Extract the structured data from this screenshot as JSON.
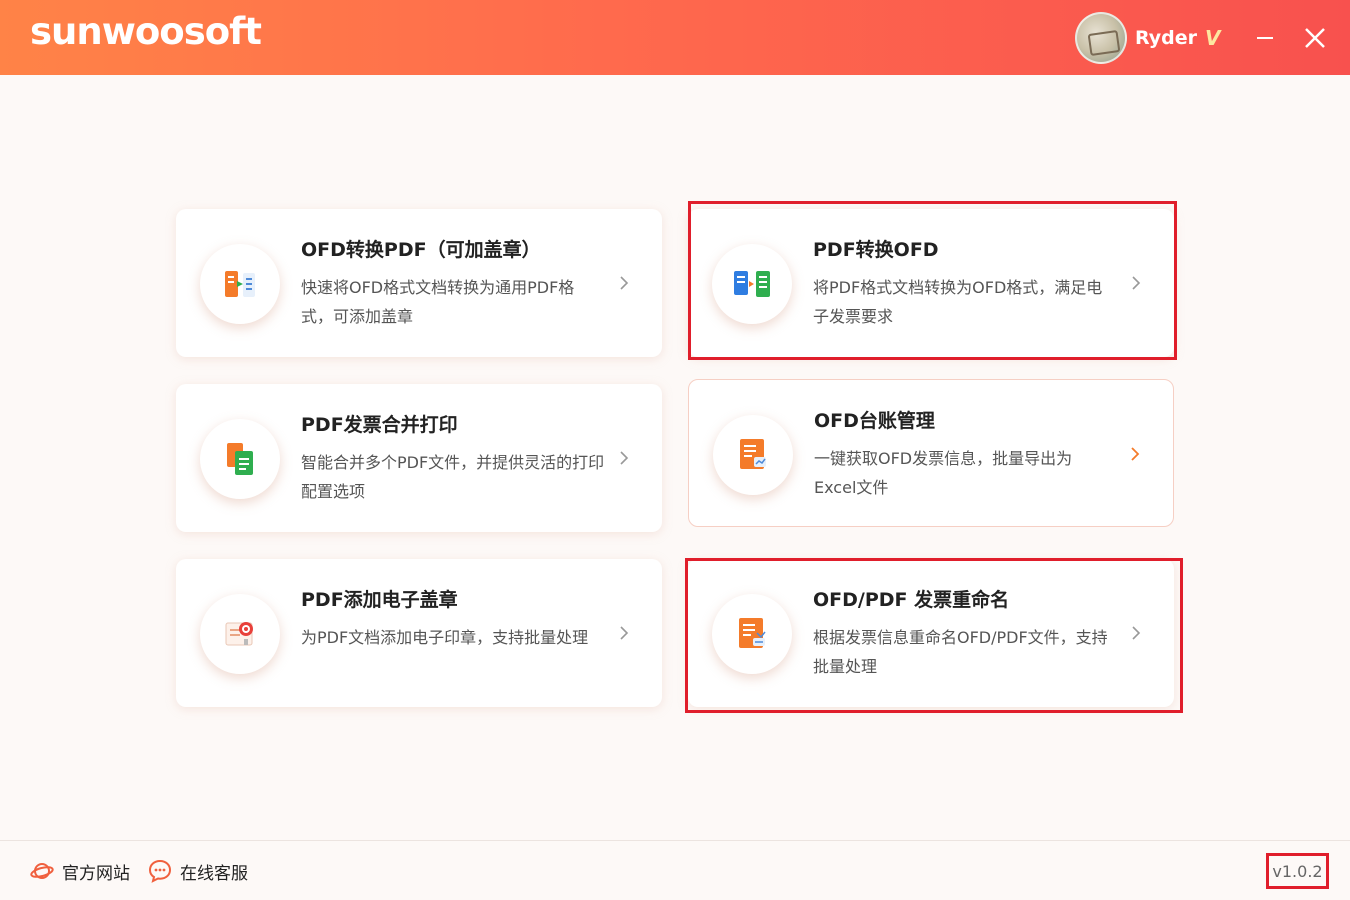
{
  "app": {
    "logo": "sunwoosoft",
    "user": {
      "name": "Ryder",
      "badge": "V"
    },
    "colors": {
      "accent": "#ff6a4d",
      "highlight": "#e01e2b"
    }
  },
  "cards": [
    {
      "title": "OFD转换PDF（可加盖章）",
      "desc": "快速将OFD格式文档转换为通用PDF格式，可添加盖章"
    },
    {
      "title": "PDF转换OFD",
      "desc": "将PDF格式文档转换为OFD格式，满足电子发票要求"
    },
    {
      "title": "PDF发票合并打印",
      "desc": "智能合并多个PDF文件，并提供灵活的打印配置选项"
    },
    {
      "title": "OFD台账管理",
      "desc": "一键获取OFD发票信息，批量导出为Excel文件"
    },
    {
      "title": "PDF添加电子盖章",
      "desc": "为PDF文档添加电子印章，支持批量处理"
    },
    {
      "title": "OFD/PDF 发票重命名",
      "desc": "根据发票信息重命名OFD/PDF文件，支持批量处理"
    }
  ],
  "footer": {
    "website": "官方网站",
    "support": "在线客服",
    "version": "v1.0.2"
  }
}
